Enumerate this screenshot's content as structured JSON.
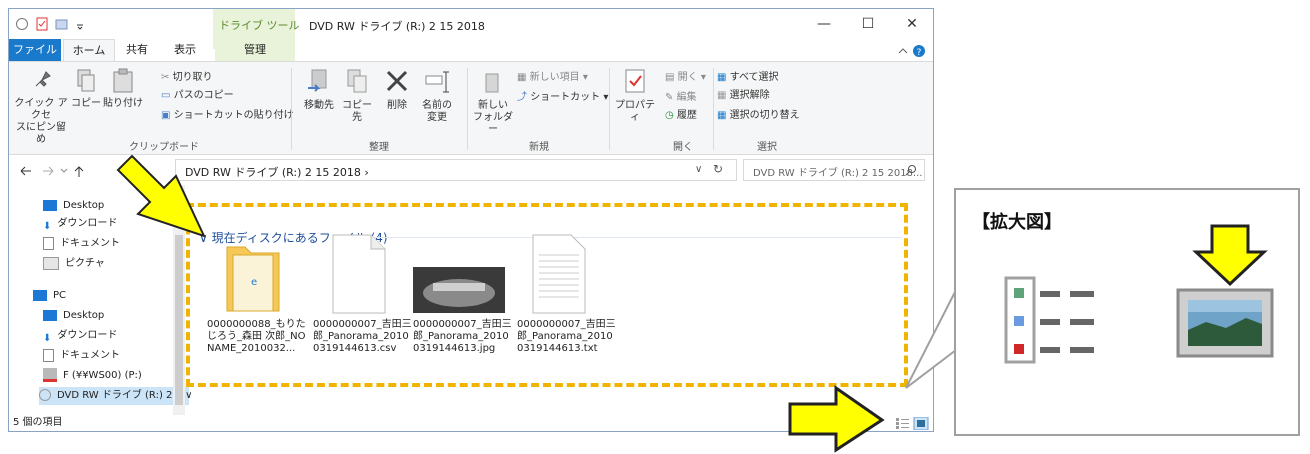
{
  "window": {
    "title": "DVD RW ドライブ (R:) 2 15 2018",
    "context_tab": "ドライブ ツール",
    "minimize": "—",
    "maximize": "☐",
    "close": "✕"
  },
  "tabs": [
    "ファイル",
    "ホーム",
    "共有",
    "表示",
    "管理"
  ],
  "ribbon": {
    "pin": "クイック アクセス\nにピン留め",
    "pin_l1": "クイック アクセ",
    "pin_l2": "スにピン留め",
    "copy": "コピー",
    "paste": "貼り付け",
    "cut": "切り取り",
    "copy_path": "パスのコピー",
    "paste_shortcut": "ショートカットの貼り付け",
    "move_to": "移動先",
    "copy_to": "コピー先",
    "delete": "削除",
    "rename_l1": "名前の",
    "rename_l2": "変更",
    "new_item": "新しい項目 ▾",
    "shortcut": "ショートカット ▾",
    "new_folder_l1": "新しい",
    "new_folder_l2": "フォルダー",
    "properties": "プロパティ",
    "open": "開く ▾",
    "edit": "編集",
    "history": "履歴",
    "select_all": "すべて選択",
    "select_none": "選択解除",
    "invert": "選択の切り替え",
    "groups": {
      "clipboard": "クリップボード",
      "organize": "整理",
      "new": "新規",
      "open": "開く",
      "select": "選択"
    }
  },
  "address": {
    "path": "DVD RW ドライブ (R:) 2 15 2018  ›",
    "search_placeholder": "DVD RW ドライブ (R:) 2 15 2018...",
    "refresh": "↻",
    "dropdown": "∨"
  },
  "nav": {
    "items": [
      {
        "label": "Desktop",
        "icon": "desktop-icon"
      },
      {
        "label": "ダウンロード",
        "icon": "download-icon"
      },
      {
        "label": "ドキュメント",
        "icon": "document-icon"
      },
      {
        "label": "ピクチャ",
        "icon": "pictures-icon"
      },
      {
        "label": "PC",
        "icon": "pc-icon"
      },
      {
        "label": "Desktop",
        "icon": "desktop-icon"
      },
      {
        "label": "ダウンロード",
        "icon": "download-icon"
      },
      {
        "label": "ドキュメント",
        "icon": "document-icon"
      },
      {
        "label": "F (¥¥WS00) (P:)",
        "icon": "network-drive-icon"
      },
      {
        "label": "DVD RW ドライブ (R:) 2 1 ∨",
        "icon": "dvd-icon"
      }
    ]
  },
  "content": {
    "group_header": "∨ 現在ディスクにあるファイル (4)",
    "files": [
      {
        "name": "0000000088_もりたじろう_森田 次郎_NO NAME_2010032...",
        "type": "folder-icon"
      },
      {
        "name": "0000000007_吉田三郎_Panorama_20100319144613.csv",
        "type": "csv-file-icon"
      },
      {
        "name": "0000000007_吉田三郎_Panorama_20100319144613.jpg",
        "type": "jpg-file-icon"
      },
      {
        "name": "0000000007_吉田三郎_Panorama_20100319144613.txt",
        "type": "txt-file-icon"
      }
    ]
  },
  "status": {
    "count": "5 個の項目"
  },
  "callout": {
    "title": "【拡大図】"
  },
  "colors": {
    "accent": "#1979ca",
    "highlight": "#f0b400",
    "arrow": "#ffff00"
  }
}
